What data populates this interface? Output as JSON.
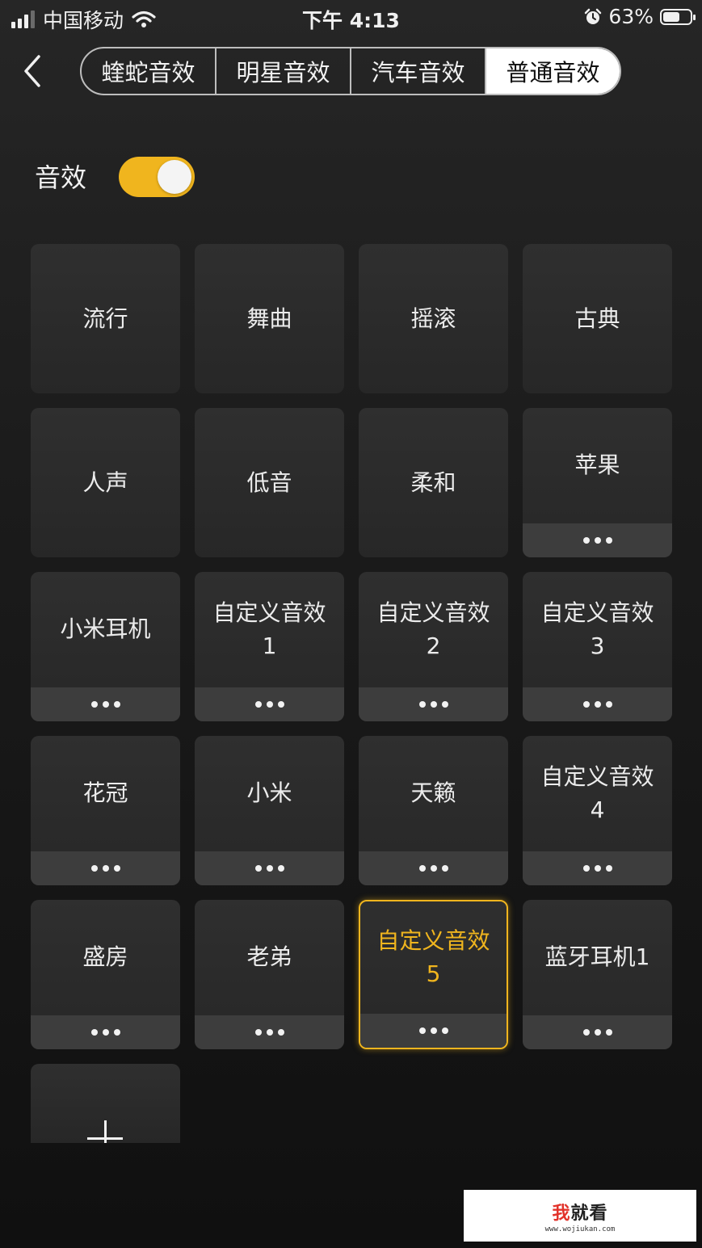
{
  "status_bar": {
    "carrier": "中国移动",
    "time": "下午 4:13",
    "battery_text": "63%",
    "battery_level": 0.63,
    "signal_bars": 4,
    "signal_strength": 3
  },
  "tabs": [
    {
      "label": "蝰蛇音效",
      "active": false
    },
    {
      "label": "明星音效",
      "active": false
    },
    {
      "label": "汽车音效",
      "active": false
    },
    {
      "label": "普通音效",
      "active": true
    }
  ],
  "effect_toggle": {
    "label": "音效",
    "on": true
  },
  "accent_color": "#f0b51e",
  "presets": [
    {
      "label": "流行",
      "more": false
    },
    {
      "label": "舞曲",
      "more": false
    },
    {
      "label": "摇滚",
      "more": false
    },
    {
      "label": "古典",
      "more": false
    },
    {
      "label": "人声",
      "more": false
    },
    {
      "label": "低音",
      "more": false
    },
    {
      "label": "柔和",
      "more": false
    },
    {
      "label": "苹果",
      "more": true
    },
    {
      "label": "小米耳机",
      "more": true
    },
    {
      "label": "自定义音效\n1",
      "more": true
    },
    {
      "label": "自定义音效\n2",
      "more": true
    },
    {
      "label": "自定义音效\n3",
      "more": true
    },
    {
      "label": "花冠",
      "more": true
    },
    {
      "label": "小米",
      "more": true
    },
    {
      "label": "天籁",
      "more": true
    },
    {
      "label": "自定义音效\n4",
      "more": true
    },
    {
      "label": "盛房",
      "more": true
    },
    {
      "label": "老弟",
      "more": true
    },
    {
      "label": "自定义音效\n5",
      "more": true,
      "selected": true
    },
    {
      "label": "蓝牙耳机1",
      "more": true
    }
  ],
  "add_button": {
    "icon": "plus-icon"
  },
  "watermark": {
    "logo_first": "我",
    "logo_rest": "就看",
    "url": "www.wojiukan.com"
  }
}
